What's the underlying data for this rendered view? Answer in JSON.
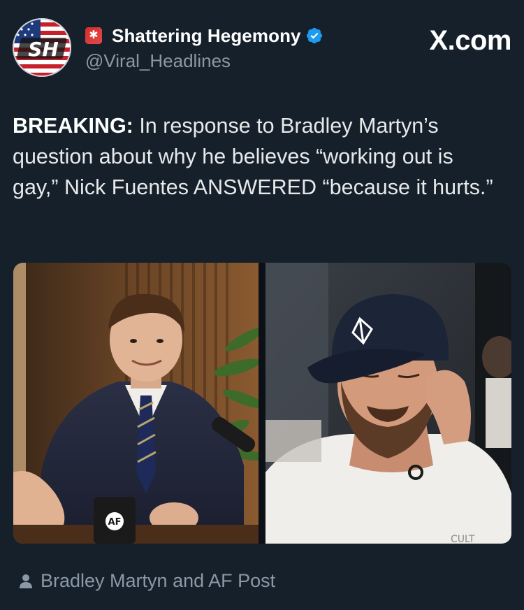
{
  "author": {
    "display_name": "Shattering Hegemony",
    "handle": "@Viral_Headlines",
    "avatar_text": "SH",
    "name_emoji": "flag-emoji-icon",
    "verified": true
  },
  "source_label": "X.com",
  "tweet": {
    "lead": "BREAKING:",
    "body": " In response to Bradley Martyn’s question about why he believes “working out is gay,” Nick Fuentes ANSWERED “because it hurts.”"
  },
  "media": {
    "left_image": "man-in-suit-photo",
    "left_mug_text": "AF",
    "right_image": "man-in-cap-photo"
  },
  "tagged_users": "Bradley Martyn and AF Post",
  "colors": {
    "background": "#15202b",
    "primary_text": "#e7e9ea",
    "secondary_text": "#8b98a5",
    "verified": "#1d9bf0"
  }
}
